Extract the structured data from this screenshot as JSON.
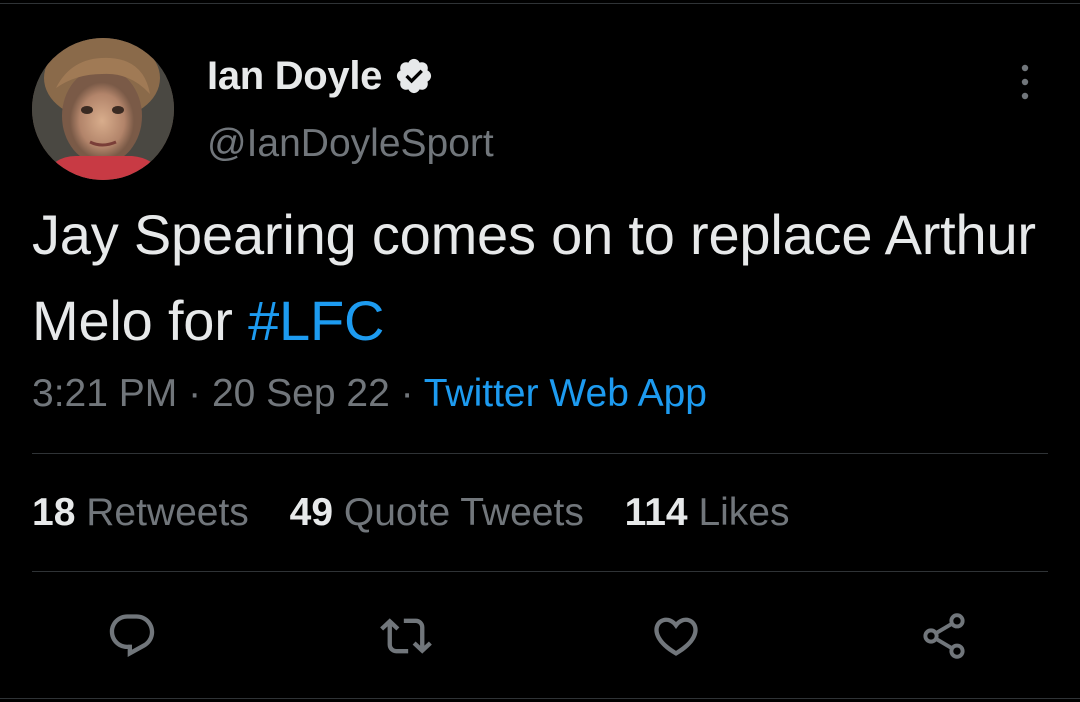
{
  "tweet": {
    "author": {
      "display_name": "Ian Doyle",
      "handle": "@IanDoyleSport",
      "verified": true,
      "avatar_icon": "profile-avatar"
    },
    "text_main": "Jay Spearing comes on to replace Arthur Melo for ",
    "hashtag": "#LFC",
    "time": "3:21 PM",
    "separator": "·",
    "date": "20 Sep 22",
    "source": "Twitter Web App",
    "stats": {
      "retweets_count": "18",
      "retweets_label": "Retweets",
      "quotes_count": "49",
      "quotes_label": "Quote Tweets",
      "likes_count": "114",
      "likes_label": "Likes"
    },
    "actions": {
      "reply_icon": "reply-icon",
      "retweet_icon": "retweet-icon",
      "like_icon": "like-icon",
      "share_icon": "share-icon"
    }
  },
  "colors": {
    "background": "#000000",
    "text_primary": "#e7e9ea",
    "text_secondary": "#71767b",
    "accent": "#1d9bf0",
    "divider": "#2f3336"
  }
}
